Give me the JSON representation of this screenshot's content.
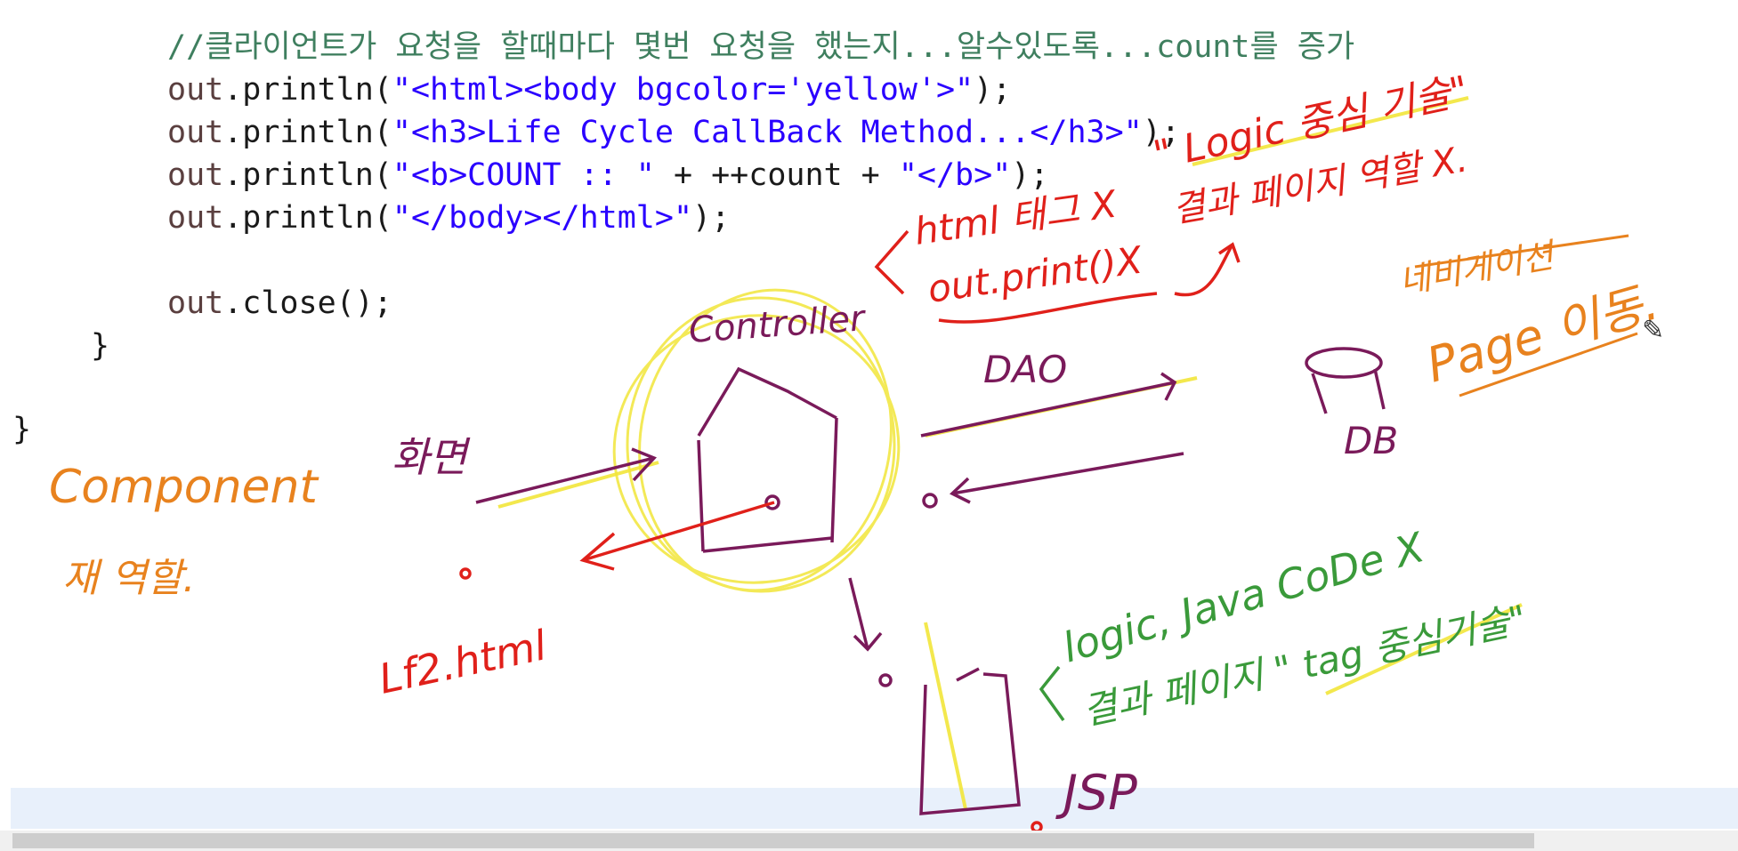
{
  "code": {
    "lines": [
      {
        "indent": "        ",
        "comment": "//클라이언트가 요청을 할때마다 몇번 요청을 했는지...알수있도록...count를 증가"
      },
      {
        "indent": "        ",
        "obj": "out",
        "call": ".println(",
        "str": "\"<html><body bgcolor='yellow'>\"",
        "end": ");"
      },
      {
        "indent": "        ",
        "obj": "out",
        "call": ".println(",
        "str": "\"<h3>Life Cycle CallBack Method...</h3>\"",
        "end": ");"
      },
      {
        "indent": "        ",
        "obj": "out",
        "call": ".println(",
        "str": "\"<b>COUNT :: \"",
        "mid": "+ ++count +",
        "str2": "\"</b>\"",
        "end": ");"
      },
      {
        "indent": "        ",
        "obj": "out",
        "call": ".println(",
        "str": "\"</body></html>\"",
        "end": ");"
      },
      {
        "indent": "        ",
        "obj": "out",
        "call": ".close();"
      },
      {
        "brace": "}"
      },
      {
        "brace": "}"
      }
    ]
  },
  "annotations": {
    "component": "Component",
    "component_role": "재 역할.",
    "screen": "화면",
    "controller": "Controller",
    "dao": "DAO",
    "db": "DB",
    "jsp": "JSP",
    "html_file": "Lf2.html",
    "html_tag": "html 태그 X",
    "out_print": "out.print()X",
    "logic_quote": "\" Logic 중심 기술\"",
    "result_page": "결과 페이지 역할 X.",
    "navigation": "네비게이션",
    "page_move": "Page 이동.",
    "logic_java": "logic, Java CoDe X",
    "tag_quote": "결과 페이지 \" tag 중심기술\""
  },
  "colors": {
    "orange": "#e8821e",
    "red": "#e0201a",
    "purple": "#7a1a5a",
    "green": "#3a9a3a",
    "yellow": "#f2e63a"
  }
}
